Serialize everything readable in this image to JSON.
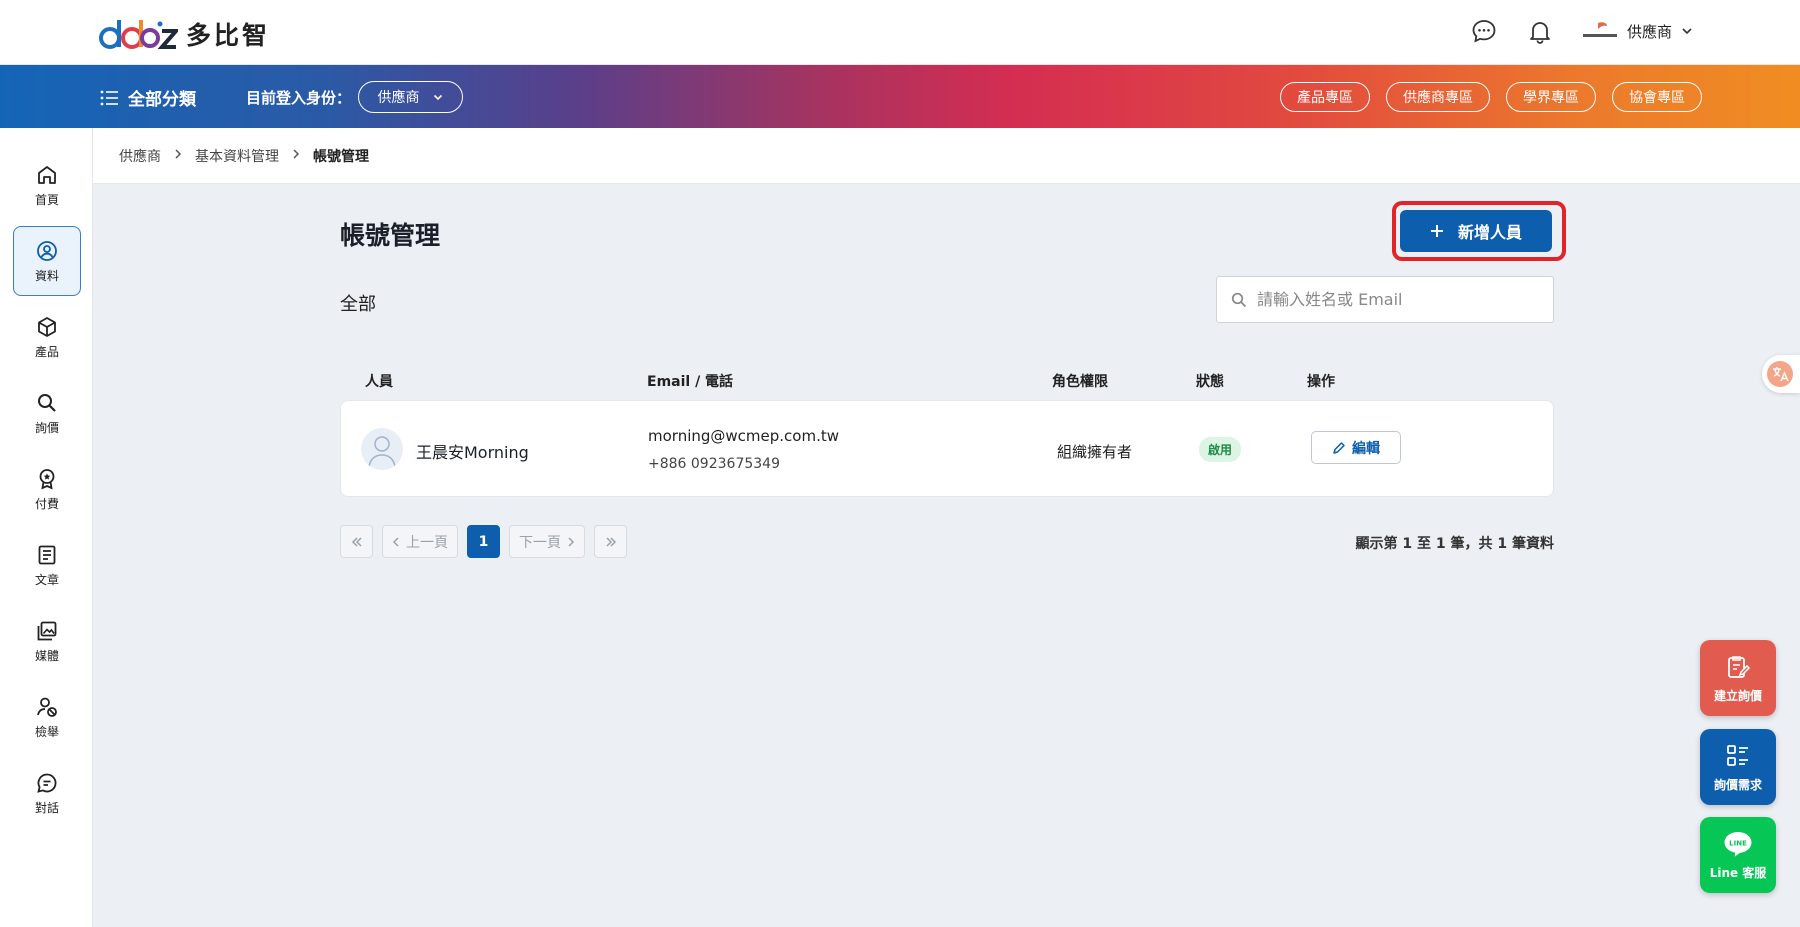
{
  "brand": {
    "name": "多比智"
  },
  "header": {
    "account_name": "供應商"
  },
  "navbar": {
    "all_categories": "全部分類",
    "login_as_label": "目前登入身份：",
    "role_value": "供應商",
    "zones": [
      "產品專區",
      "供應商專區",
      "學界專區",
      "協會專區"
    ]
  },
  "sidebar": {
    "items": [
      {
        "label": "首頁",
        "icon": "home-icon"
      },
      {
        "label": "資料",
        "icon": "user-circle-icon"
      },
      {
        "label": "產品",
        "icon": "box-icon"
      },
      {
        "label": "詢價",
        "icon": "search-icon"
      },
      {
        "label": "付費",
        "icon": "badge-icon"
      },
      {
        "label": "文章",
        "icon": "document-icon"
      },
      {
        "label": "媒體",
        "icon": "media-icon"
      },
      {
        "label": "檢舉",
        "icon": "report-user-icon"
      },
      {
        "label": "對話",
        "icon": "chat-icon"
      }
    ]
  },
  "breadcrumb": [
    "供應商",
    "基本資料管理",
    "帳號管理"
  ],
  "page": {
    "title": "帳號管理",
    "add_button": "新增人員",
    "section_label": "全部",
    "search_placeholder": "請輸入姓名或 Email"
  },
  "table": {
    "headers": [
      "人員",
      "Email / 電話",
      "角色權限",
      "狀態",
      "操作"
    ],
    "rows": [
      {
        "name": "王晨安Morning",
        "email": "morning@wcmep.com.tw",
        "phone": "+886 0923675349",
        "role": "組織擁有者",
        "status": "啟用",
        "action": "編輯"
      }
    ]
  },
  "pagination": {
    "prev": "上一頁",
    "current": "1",
    "next": "下一頁",
    "info": "顯示第 1 至 1 筆，共 1 筆資料"
  },
  "floating": {
    "create_quote": "建立詢價",
    "quote_needs": "詢價需求",
    "line_service": "Line 客服",
    "line_icon_text": "LINE"
  },
  "colors": {
    "primary": "#0d5ead",
    "highlight": "#e0242a",
    "status_green": "#1f8a46",
    "line_green": "#06c755",
    "quote_red": "#e15c4f"
  }
}
